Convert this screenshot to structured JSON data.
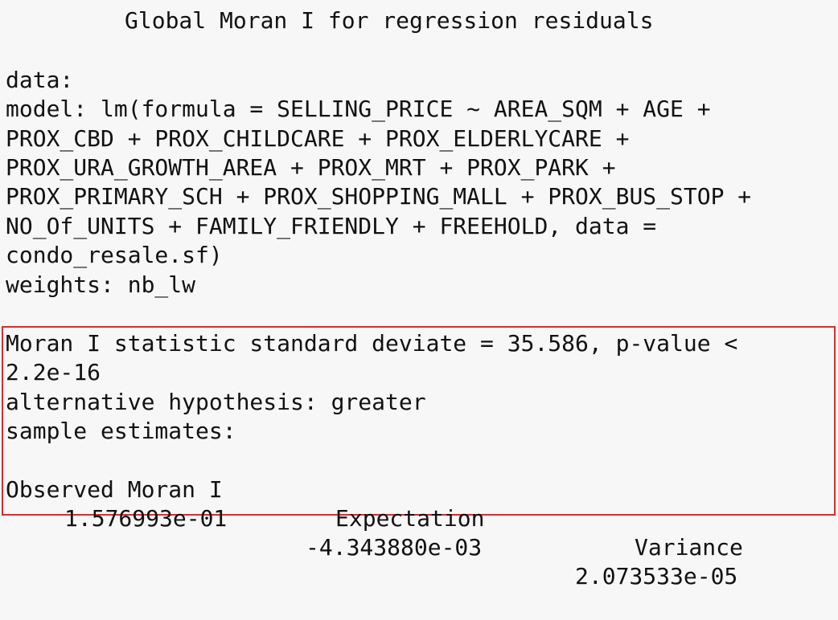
{
  "output": {
    "title": "Global Moran I for regression residuals",
    "data_line": "data:",
    "model_lines": [
      "model: lm(formula = SELLING_PRICE ~ AREA_SQM + AGE +",
      "PROX_CBD + PROX_CHILDCARE + PROX_ELDERLYCARE +",
      "PROX_URA_GROWTH_AREA + PROX_MRT + PROX_PARK +",
      "PROX_PRIMARY_SCH + PROX_SHOPPING_MALL + PROX_BUS_STOP +",
      "NO_Of_UNITS + FAMILY_FRIENDLY + FREEHOLD, data =",
      "condo_resale.sf)"
    ],
    "weights_line": "weights: nb_lw"
  },
  "result": {
    "statistic_line": "Moran I statistic standard deviate = 35.586, p-value <",
    "pvalue_cont": "2.2e-16",
    "alternative_line": "alternative hypothesis: greater",
    "estimates_label": "sample estimates:",
    "headers": [
      "Observed Moran I",
      "Expectation",
      "Variance"
    ],
    "values": [
      "1.576993e-01",
      "-4.343880e-03",
      "2.073533e-05"
    ]
  },
  "colors": {
    "highlight_border": "#d32f2f",
    "background": "#f7f7f7",
    "text": "#111111"
  }
}
